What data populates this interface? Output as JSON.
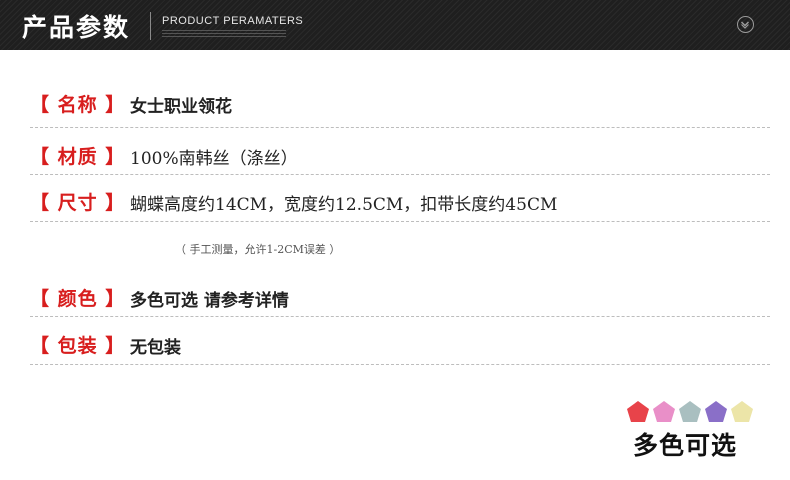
{
  "header": {
    "title": "产品参数",
    "subtitle": "PRODUCT PERAMATERS"
  },
  "params": [
    {
      "label": "【 名称 】",
      "value": "女士职业领花"
    },
    {
      "label": "【 材质 】",
      "value": "100%南韩丝（涤丝）"
    },
    {
      "label": "【 尺寸 】",
      "value": "蝴蝶高度约14CM，宽度约12.5CM，扣带长度约45CM"
    },
    {
      "label": "【 颜色 】",
      "value": "多色可选 请参考详情"
    },
    {
      "label": "【 包装 】",
      "value": "无包装"
    }
  ],
  "note": "（ 手工测量，允许1-2CM误差 ）",
  "colors": {
    "caption": "多色可选",
    "swatches": [
      "#e8434a",
      "#e98fc8",
      "#a9bfc0",
      "#8a6fc8",
      "#ece5a8"
    ]
  }
}
